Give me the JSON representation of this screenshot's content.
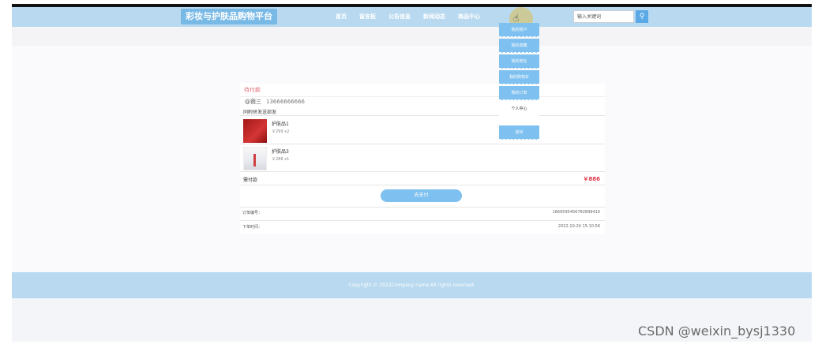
{
  "header": {
    "brand": "彩妆与护肤品购物平台",
    "nav": [
      "首页",
      "留言板",
      "公告信息",
      "新闻动态",
      "商品中心"
    ],
    "search_placeholder": "输入关键词",
    "search_icon": "search-icon"
  },
  "dropdown": {
    "items": [
      "我的账户",
      "我的收藏",
      "我的地址",
      "我的购物车",
      "我的订单"
    ],
    "personal": "个人中心",
    "logout": "退出"
  },
  "order": {
    "status": "待付款",
    "name": "@薇三",
    "phone": "13666666666",
    "address": "同附研发送部发",
    "products": [
      {
        "name": "护肤品1",
        "price": "￥299 x2"
      },
      {
        "name": "护肤品3",
        "price": "￥288 x1"
      }
    ],
    "pay_label": "需付款",
    "pay_amount": "￥886",
    "pay_button": "去支付",
    "order_no_label": "订单编号：",
    "order_no": "1666595456782899410",
    "time_label": "下单时间：",
    "time": "2022-10-24 15:10:56"
  },
  "footer": {
    "copyright": "Copyright © 2022Company name All rights reserved."
  },
  "watermark": "CSDN @weixin_bysj1330",
  "colors": {
    "header_bg": "#b8d9ef",
    "accent": "#7ec0ef",
    "price_red": "#e0354a",
    "status_pink": "#e06c7a"
  }
}
